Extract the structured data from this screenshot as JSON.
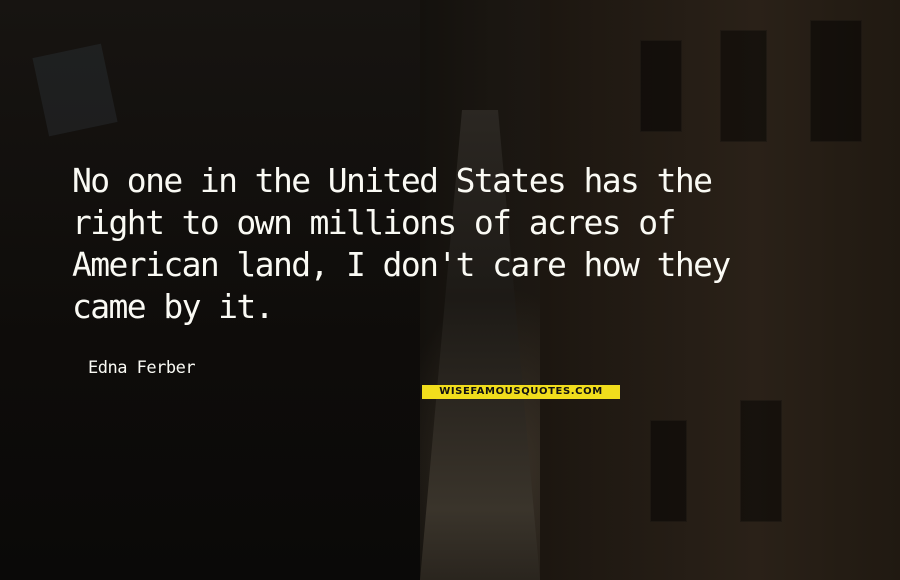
{
  "quote": {
    "lines": [
      "No one in the United States has the",
      "right to own millions of acres of",
      "American land, I don't care how they",
      "came by it."
    ]
  },
  "author": {
    "name": "Edna Ferber"
  },
  "logo": {
    "text": "WISEFAMOUSQUOTES.COM"
  },
  "colors": {
    "text": "#fafaf4",
    "logo_bg": "#f1dd1c"
  }
}
